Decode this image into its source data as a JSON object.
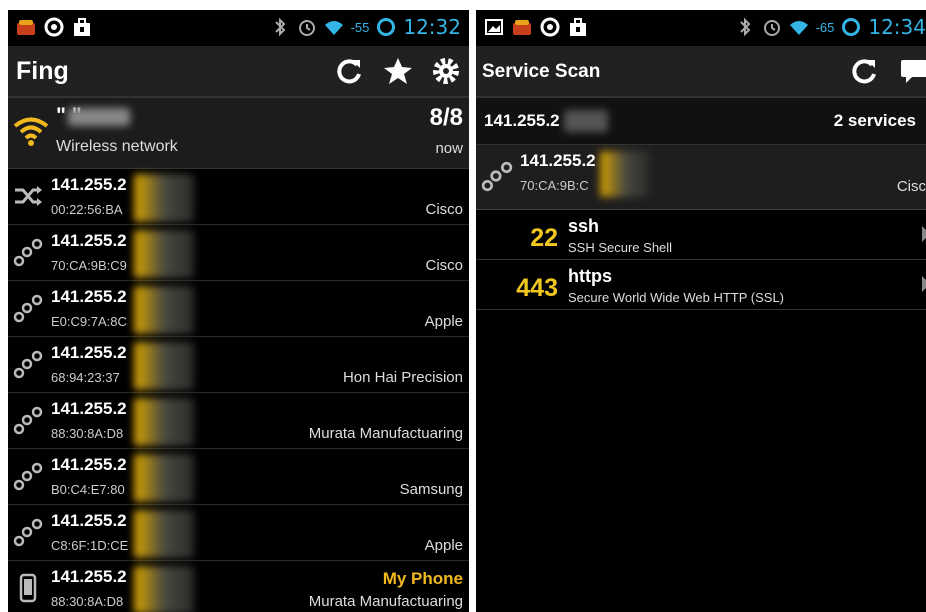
{
  "left": {
    "status": {
      "time": "12:32",
      "signal": "-55"
    },
    "app_title": "Fing",
    "network": {
      "name": "\"       \"",
      "type": "Wireless network",
      "count": "8/8",
      "when": "now"
    },
    "devices": [
      {
        "ip": "141.255.2",
        "mac": "00:22:56:BA",
        "vendor": "Cisco",
        "icon": "shuffle-icon"
      },
      {
        "ip": "141.255.2",
        "mac": "70:CA:9B:C9",
        "vendor": "Cisco",
        "icon": "link-icon"
      },
      {
        "ip": "141.255.2",
        "mac": "E0:C9:7A:8C",
        "vendor": "Apple",
        "icon": "link-icon"
      },
      {
        "ip": "141.255.2",
        "mac": "68:94:23:37",
        "vendor": "Hon Hai Precision",
        "icon": "link-icon"
      },
      {
        "ip": "141.255.2",
        "mac": "88:30:8A:D8",
        "vendor": "Murata Manufactuaring",
        "icon": "link-icon"
      },
      {
        "ip": "141.255.2",
        "mac": "B0:C4:E7:80",
        "vendor": "Samsung",
        "icon": "link-icon"
      },
      {
        "ip": "141.255.2",
        "mac": "C8:6F:1D:CE",
        "vendor": "Apple",
        "icon": "link-icon"
      },
      {
        "ip": "141.255.2",
        "mac": "88:30:8A:D8",
        "vendor": "Murata Manufactuaring",
        "icon": "phone-icon",
        "tag": "My Phone"
      }
    ]
  },
  "right": {
    "status": {
      "time": "12:34",
      "signal": "-65"
    },
    "app_title": "Service Scan",
    "header": {
      "ip": "141.255.2",
      "services": "2 services"
    },
    "host": {
      "ip": "141.255.2",
      "mac": "70:CA:9B:C",
      "vendor": "Cisc"
    },
    "services": [
      {
        "port": "22",
        "name": "ssh",
        "desc": "SSH Secure Shell"
      },
      {
        "port": "443",
        "name": "https",
        "desc": "Secure World Wide Web HTTP (SSL)"
      }
    ]
  },
  "colors": {
    "accent": "#f2c81e",
    "status_blue": "#33b5e5",
    "background": "#000000"
  }
}
